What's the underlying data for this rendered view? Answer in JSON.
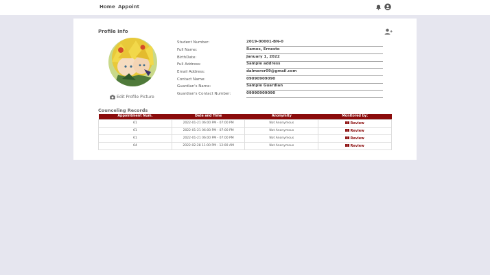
{
  "nav": {
    "home": "Home",
    "appoint": "Appoint",
    "icons": [
      "bell-icon",
      "user-circle-icon"
    ]
  },
  "profile": {
    "title": "Profile Info",
    "edit_picture": "Edit Profile Picture",
    "fields": [
      {
        "label": "Student Number:",
        "value": "2019-00001-BN-0"
      },
      {
        "label": "Full Name:",
        "value": "Ramos, Ernesto"
      },
      {
        "label": "BirthDate:",
        "value": "January 1, 2022"
      },
      {
        "label": "Full Address:",
        "value": "Sample address"
      },
      {
        "label": "Email Address:",
        "value": "dalmerer09@gmail.com"
      },
      {
        "label": "Contact Name:",
        "value": "09090909090"
      },
      {
        "label": "Guardian's Name:",
        "value": "Sample Guardian"
      },
      {
        "label": "Guardian's Contact Number:",
        "value": "09090909090"
      }
    ]
  },
  "records": {
    "title": "Counceling Records",
    "headers": [
      "Appointment Num.",
      "Date and Time",
      "Anonymity",
      "Monitored by:"
    ],
    "rows": [
      {
        "num": "61",
        "datetime": "2022-01-21 06:00 PM - 07:00 PM",
        "anonymity": "Not Anonymous",
        "action": "Review"
      },
      {
        "num": "61",
        "datetime": "2022-01-21 06:00 PM - 07:00 PM",
        "anonymity": "Not Anonymous",
        "action": "Review"
      },
      {
        "num": "61",
        "datetime": "2022-01-21 06:00 PM - 07:00 PM",
        "anonymity": "Not Anonymous",
        "action": "Review"
      },
      {
        "num": "64",
        "datetime": "2022-02-28 11:00 PM - 12:00 AM",
        "anonymity": "Not Anonymous",
        "action": "Review"
      }
    ]
  },
  "colors": {
    "accent": "#8b0c0c",
    "background": "#e6e6ef"
  }
}
